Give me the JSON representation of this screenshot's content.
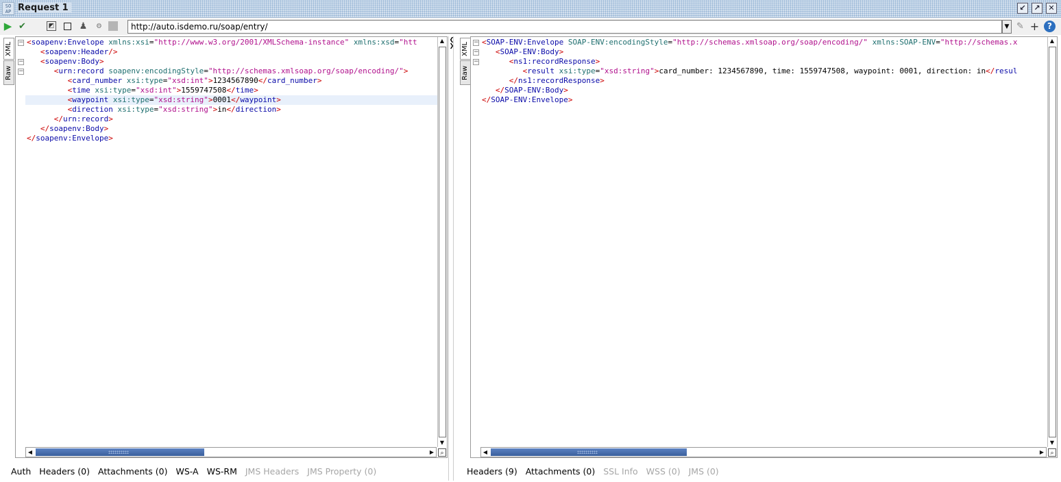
{
  "window": {
    "title": "Request 1",
    "icon_text": "SO\nAP"
  },
  "toolbar": {
    "url": "http://auto.isdemo.ru/soap/entry/",
    "icons": [
      "run-icon",
      "check-icon",
      "aspect-icon",
      "stop-icon",
      "user-icon",
      "ws-icon",
      "cancel-icon"
    ]
  },
  "request": {
    "side_tabs": [
      "XML",
      "Raw"
    ],
    "lines": [
      "<soapenv:Envelope xmlns:xsi=\"http://www.w3.org/2001/XMLSchema-instance\" xmlns:xsd=\"htt",
      "   <soapenv:Header/>",
      "   <soapenv:Body>",
      "      <urn:record soapenv:encodingStyle=\"http://schemas.xmlsoap.org/soap/encoding/\">",
      "         <card_number xsi:type=\"xsd:int\">1234567890</card_number>",
      "         <time xsi:type=\"xsd:int\">1559747508</time>",
      "         <waypoint xsi:type=\"xsd:string\">0001</waypoint>",
      "         <direction xsi:type=\"xsd:string\">in</direction>",
      "      </urn:record>",
      "   </soapenv:Body>",
      "</soapenv:Envelope>"
    ],
    "tabs": [
      {
        "label": "Auth",
        "enabled": true
      },
      {
        "label": "Headers (0)",
        "enabled": true
      },
      {
        "label": "Attachments (0)",
        "enabled": true
      },
      {
        "label": "WS-A",
        "enabled": true
      },
      {
        "label": "WS-RM",
        "enabled": true
      },
      {
        "label": "JMS Headers",
        "enabled": false
      },
      {
        "label": "JMS Property (0)",
        "enabled": false
      }
    ]
  },
  "response": {
    "side_tabs": [
      "XML",
      "Raw"
    ],
    "lines": [
      "<SOAP-ENV:Envelope SOAP-ENV:encodingStyle=\"http://schemas.xmlsoap.org/soap/encoding/\" xmlns:SOAP-ENV=\"http://schemas.x",
      "   <SOAP-ENV:Body>",
      "      <ns1:recordResponse>",
      "         <result xsi:type=\"xsd:string\">card_number: 1234567890, time: 1559747508, waypoint: 0001, direction: in</resul",
      "      </ns1:recordResponse>",
      "   </SOAP-ENV:Body>",
      "</SOAP-ENV:Envelope>"
    ],
    "tabs": [
      {
        "label": "Headers (9)",
        "enabled": true
      },
      {
        "label": "Attachments (0)",
        "enabled": true
      },
      {
        "label": "SSL Info",
        "enabled": false
      },
      {
        "label": "WSS (0)",
        "enabled": false
      },
      {
        "label": "JMS (0)",
        "enabled": false
      }
    ]
  }
}
